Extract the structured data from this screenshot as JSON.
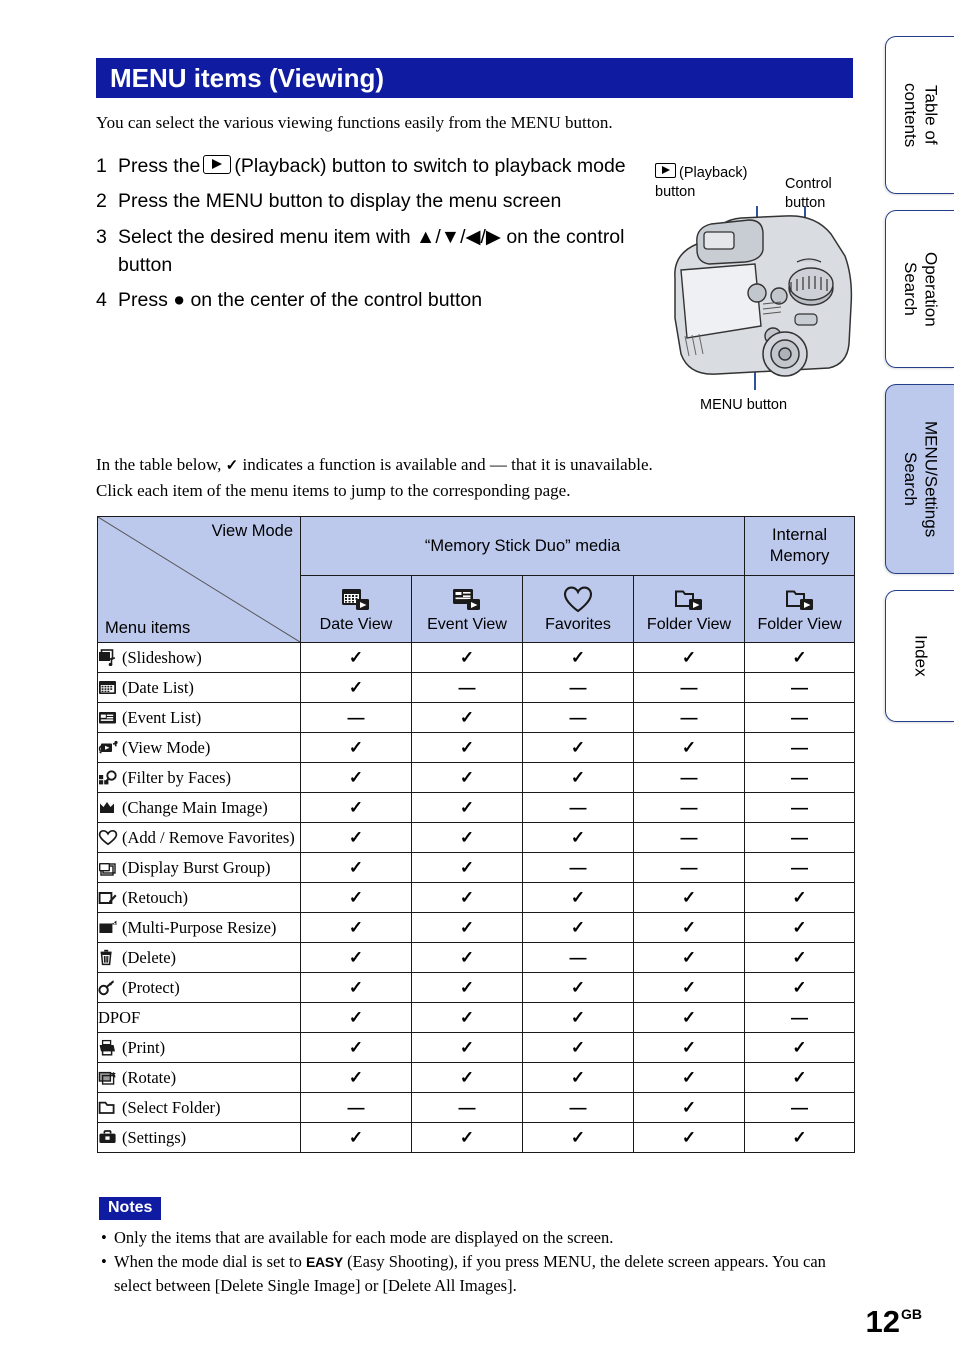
{
  "header": {
    "title": "MENU items (Viewing)"
  },
  "intro": "You can select the various viewing functions easily from the MENU button.",
  "steps": [
    {
      "num": "1",
      "pre": "Press the",
      "icon": "playback-icon",
      "post": "(Playback) button to switch to playback mode"
    },
    {
      "num": "2",
      "pre": "",
      "icon": "",
      "post": "Press the MENU button to display the menu screen"
    },
    {
      "num": "3",
      "pre": "",
      "icon": "",
      "post": "Select the desired menu item with ▲/▼/◀/▶ on the control button"
    },
    {
      "num": "4",
      "pre": "",
      "icon": "",
      "post": "Press ● on the center of the control button"
    }
  ],
  "figure": {
    "playback_label_line1": "(Playback)",
    "playback_label_line2": "button",
    "control_label_line1": "Control",
    "control_label_line2": "button",
    "menu_label": "MENU button"
  },
  "table_intro": {
    "line1_before": "In the table below,",
    "line1_check": "✓",
    "line1_after": "indicates a function is available and — that it is unavailable.",
    "line2": "Click each item of the menu items to jump to the corresponding page."
  },
  "table": {
    "corner_top": "View Mode",
    "corner_bottom": "Menu items",
    "group_media": "“Memory Stick Duo” media",
    "group_internal_line1": "Internal",
    "group_internal_line2": "Memory",
    "columns": [
      {
        "label": "Date View",
        "icon": "date-view-icon"
      },
      {
        "label": "Event View",
        "icon": "event-view-icon"
      },
      {
        "label": "Favorites",
        "icon": "favorites-heart-icon"
      },
      {
        "label": "Folder View",
        "icon": "folder-view-icon"
      },
      {
        "label": "Folder View",
        "icon": "folder-view-icon"
      }
    ],
    "check": "✓",
    "dash": "—",
    "rows": [
      {
        "icon": "slideshow-icon",
        "label": "(Slideshow)",
        "marks": [
          "check",
          "check",
          "check",
          "check",
          "check"
        ]
      },
      {
        "icon": "date-list-icon",
        "label": "(Date List)",
        "marks": [
          "check",
          "dash",
          "dash",
          "dash",
          "dash"
        ]
      },
      {
        "icon": "event-list-icon",
        "label": "(Event List)",
        "marks": [
          "dash",
          "check",
          "dash",
          "dash",
          "dash"
        ]
      },
      {
        "icon": "view-mode-icon",
        "label": "(View Mode)",
        "marks": [
          "check",
          "check",
          "check",
          "check",
          "dash"
        ]
      },
      {
        "icon": "filter-faces-icon",
        "label": "(Filter by Faces)",
        "marks": [
          "check",
          "check",
          "check",
          "dash",
          "dash"
        ]
      },
      {
        "icon": "change-main-image-icon",
        "label": "(Change Main Image)",
        "marks": [
          "check",
          "check",
          "dash",
          "dash",
          "dash"
        ]
      },
      {
        "icon": "heart-icon",
        "label": "(Add / Remove Favorites)",
        "marks": [
          "check",
          "check",
          "check",
          "dash",
          "dash"
        ]
      },
      {
        "icon": "burst-group-icon",
        "label": "(Display Burst Group)",
        "marks": [
          "check",
          "check",
          "dash",
          "dash",
          "dash"
        ]
      },
      {
        "icon": "retouch-icon",
        "label": "(Retouch)",
        "marks": [
          "check",
          "check",
          "check",
          "check",
          "check"
        ]
      },
      {
        "icon": "multi-resize-icon",
        "label": "(Multi-Purpose Resize)",
        "marks": [
          "check",
          "check",
          "check",
          "check",
          "check"
        ]
      },
      {
        "icon": "delete-trash-icon",
        "label": "(Delete)",
        "marks": [
          "check",
          "check",
          "dash",
          "check",
          "check"
        ]
      },
      {
        "icon": "protect-key-icon",
        "label": "(Protect)",
        "marks": [
          "check",
          "check",
          "check",
          "check",
          "check"
        ]
      },
      {
        "icon": "",
        "label": "DPOF",
        "marks": [
          "check",
          "check",
          "check",
          "check",
          "dash"
        ]
      },
      {
        "icon": "print-icon",
        "label": "(Print)",
        "marks": [
          "check",
          "check",
          "check",
          "check",
          "check"
        ]
      },
      {
        "icon": "rotate-icon",
        "label": "(Rotate)",
        "marks": [
          "check",
          "check",
          "check",
          "check",
          "check"
        ]
      },
      {
        "icon": "select-folder-icon",
        "label": "(Select Folder)",
        "marks": [
          "dash",
          "dash",
          "dash",
          "check",
          "dash"
        ]
      },
      {
        "icon": "settings-toolbox-icon",
        "label": "(Settings)",
        "marks": [
          "check",
          "check",
          "check",
          "check",
          "check"
        ]
      }
    ]
  },
  "notes": {
    "badge": "Notes",
    "items": [
      {
        "text": "Only the items that are available for each mode are displayed on the screen."
      },
      {
        "pre": "When the mode dial is set to",
        "tag": "EASY",
        "post": "(Easy Shooting), if you press MENU, the delete screen appears. You can select between [Delete Single Image] or [Delete All Images]."
      }
    ]
  },
  "page_number": {
    "value": "12",
    "suffix": "GB"
  },
  "sidebar": {
    "tabs": [
      {
        "label": "Table of\ncontents",
        "active": false
      },
      {
        "label": "Operation\nSearch",
        "active": false
      },
      {
        "label": "MENU/Settings\nSearch",
        "active": true
      },
      {
        "label": "Index",
        "active": false
      }
    ]
  },
  "colors": {
    "title_bar": "#0f1ba0",
    "table_header": "#bcc9ec",
    "tab_border": "#243f87",
    "callout_line": "#1a3f8f"
  }
}
